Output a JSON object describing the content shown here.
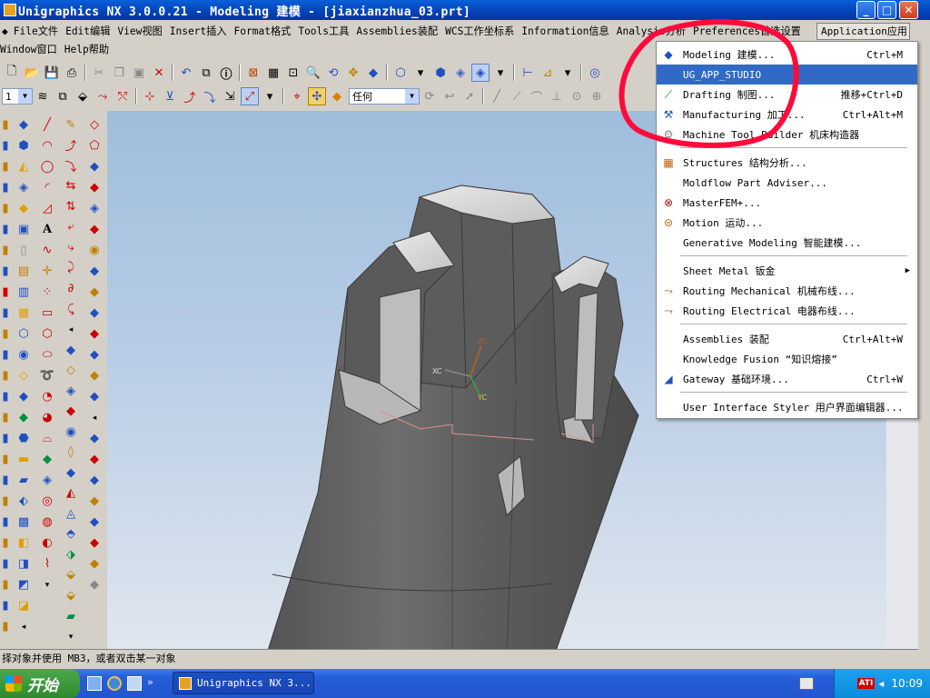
{
  "window": {
    "title": "Unigraphics NX 3.0.0.21 - Modeling 建模 - [jiaxianzhua_03.prt]",
    "min": "_",
    "max": "□",
    "close": "✕"
  },
  "menubar": {
    "row1": [
      "File文件",
      "Edit编辑",
      "View视图",
      "Insert插入",
      "Format格式",
      "Tools工具",
      "Assemblies装配",
      "WCS工作坐标系",
      "Information信息",
      "Analysis分析",
      "Preferences首选设置"
    ],
    "application": "Application应用",
    "row2": [
      "Window窗口",
      "Help帮助"
    ]
  },
  "toolbar": {
    "layer_combo": "1",
    "filter_combo": "任何"
  },
  "viewport": {
    "axis_zc": "ZC",
    "axis_xc": "XC",
    "axis_yc": "YC"
  },
  "app_menu": {
    "items": [
      {
        "label": "Modeling 建模...",
        "shortcut": "Ctrl+M",
        "icon": "modeling-icon"
      },
      {
        "label": "UG_APP_STUDIO",
        "shortcut": "",
        "icon": "",
        "highlighted": true
      },
      {
        "label": "Drafting 制图...",
        "shortcut": "推移+Ctrl+D",
        "icon": "drafting-icon"
      },
      {
        "label": "Manufacturing 加工...",
        "shortcut": "Ctrl+Alt+M",
        "icon": "manufacturing-icon"
      },
      {
        "label": "Machine Tool Builder 机床构造器",
        "shortcut": "",
        "icon": "machine-tool-icon"
      },
      {
        "label": "Structures 结构分析...",
        "shortcut": "",
        "icon": "structures-icon"
      },
      {
        "label": "Moldflow Part Adviser...",
        "shortcut": "",
        "icon": ""
      },
      {
        "label": "MasterFEM+...",
        "shortcut": "",
        "icon": "masterfem-icon"
      },
      {
        "label": "Motion 运动...",
        "shortcut": "",
        "icon": "motion-icon"
      },
      {
        "label": "Generative Modeling 智能建模...",
        "shortcut": "",
        "icon": ""
      },
      {
        "label": "Sheet Metal 钣金",
        "shortcut": "",
        "icon": "",
        "submenu": true
      },
      {
        "label": "Routing Mechanical 机械布线...",
        "shortcut": "",
        "icon": "routing-mechanical-icon"
      },
      {
        "label": "Routing Electrical 电器布线...",
        "shortcut": "",
        "icon": "routing-electrical-icon"
      },
      {
        "label": "Assemblies 装配",
        "shortcut": "Ctrl+Alt+W",
        "icon": ""
      },
      {
        "label": "Knowledge Fusion “知识熔接”",
        "shortcut": "",
        "icon": ""
      },
      {
        "label": "Gateway 基础环境...",
        "shortcut": "Ctrl+W",
        "icon": "gateway-icon"
      },
      {
        "label": "User Interface Styler 用户界面编辑器...",
        "shortcut": "",
        "icon": ""
      }
    ]
  },
  "statusbar": {
    "text": "择对象并使用 MB3，或者双击某一对象"
  },
  "taskbar": {
    "start": "开始",
    "task": "Unigraphics NX 3...",
    "clock": "10:09",
    "ati": "ATI"
  },
  "colors": {
    "title_blue": "#0a5fd8",
    "menu_highlight": "#316ac5",
    "annotation_red": "#ff0a3c",
    "part_gray": "#5f5f5f"
  }
}
